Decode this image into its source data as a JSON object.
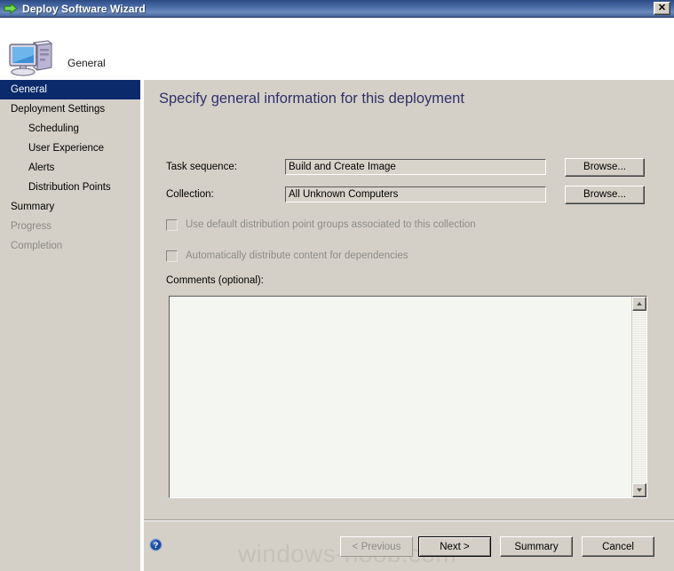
{
  "window": {
    "title": "Deploy Software Wizard",
    "title_icon": "green-right-arrow-icon",
    "close_label": "✕"
  },
  "header": {
    "icon": "computer-icon",
    "label": "General"
  },
  "sidebar": {
    "items": [
      {
        "label": "General",
        "state": "selected",
        "indent": false
      },
      {
        "label": "Deployment Settings",
        "state": "normal",
        "indent": false
      },
      {
        "label": "Scheduling",
        "state": "normal",
        "indent": true
      },
      {
        "label": "User Experience",
        "state": "normal",
        "indent": true
      },
      {
        "label": "Alerts",
        "state": "normal",
        "indent": true
      },
      {
        "label": "Distribution Points",
        "state": "normal",
        "indent": true
      },
      {
        "label": "Summary",
        "state": "normal",
        "indent": false
      },
      {
        "label": "Progress",
        "state": "disabled",
        "indent": false
      },
      {
        "label": "Completion",
        "state": "disabled",
        "indent": false
      }
    ]
  },
  "content": {
    "heading": "Specify general information for this deployment",
    "fields": {
      "task_sequence": {
        "label": "Task sequence:",
        "value": "Build and Create Image",
        "browse_label": "Browse..."
      },
      "collection": {
        "label": "Collection:",
        "value": "All Unknown Computers",
        "browse_label": "Browse..."
      }
    },
    "checkboxes": [
      {
        "label": "Use default distribution point groups associated to this collection",
        "checked": false,
        "disabled": true
      },
      {
        "label": "Automatically distribute content for dependencies",
        "checked": false,
        "disabled": true
      }
    ],
    "comments": {
      "label": "Comments (optional):",
      "value": "",
      "scroll_up": "scroll-up-arrow",
      "scroll_down": "scroll-down-arrow"
    }
  },
  "footer": {
    "help_icon": "help-question-icon",
    "buttons": {
      "previous": "< Previous",
      "next": "Next >",
      "summary": "Summary",
      "cancel": "Cancel"
    }
  },
  "watermark": "windows-noob.com",
  "colors": {
    "titlebar_blue": "#4d6fa8",
    "selection_blue": "#0a2a6b",
    "dialog_face": "#d4d0c8",
    "heading_text": "#30306a",
    "disabled_text": "#8c8c87"
  }
}
